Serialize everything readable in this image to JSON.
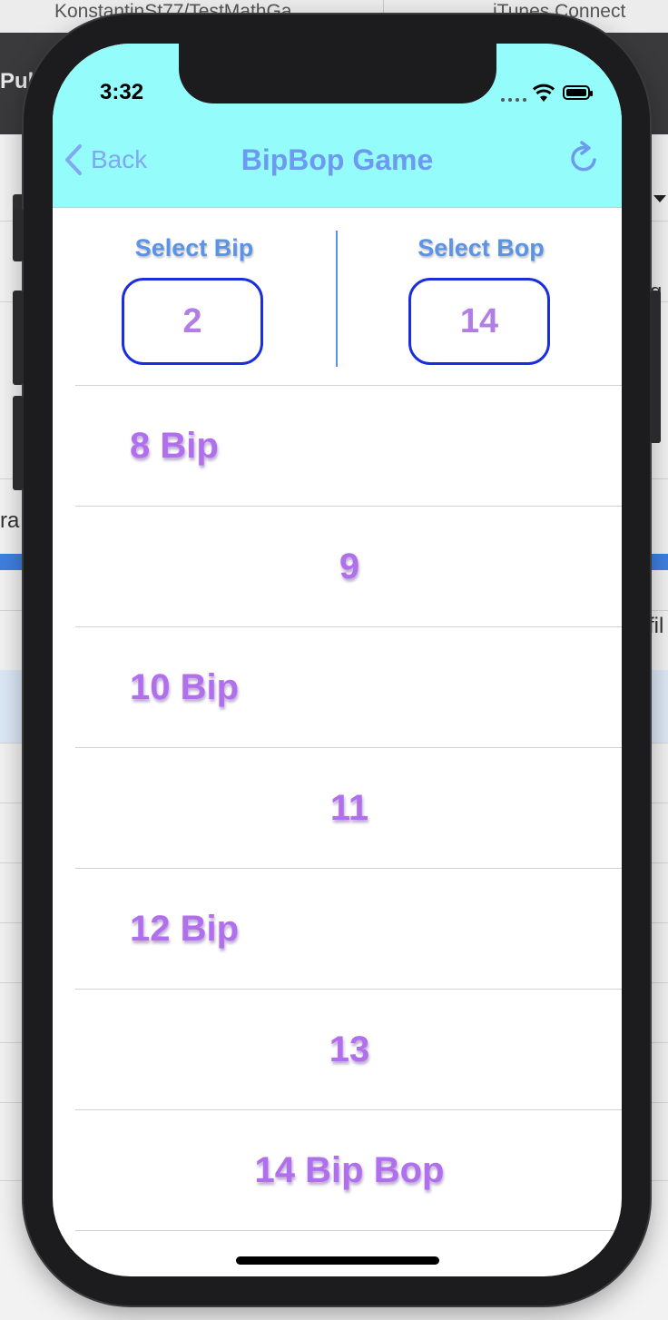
{
  "desktop": {
    "tabs": [
      "KonstantinSt77/TestMathGa",
      "iTunes Connect"
    ],
    "toolbar_text": "Pull",
    "fragments": {
      "left_mid": "ra",
      "right_top": "g",
      "right_mid": "fil"
    }
  },
  "status_bar": {
    "time": "3:32"
  },
  "nav": {
    "back_label": "Back",
    "title": "BipBop Game"
  },
  "selectors": {
    "bip": {
      "label": "Select Bip",
      "value": "2"
    },
    "bop": {
      "label": "Select Bop",
      "value": "14"
    }
  },
  "rows": [
    {
      "text": "8 Bip",
      "align": "left"
    },
    {
      "text": "9",
      "align": "center"
    },
    {
      "text": "10 Bip",
      "align": "left"
    },
    {
      "text": "11",
      "align": "center"
    },
    {
      "text": "12 Bip",
      "align": "left"
    },
    {
      "text": "13",
      "align": "center"
    },
    {
      "text": "14 Bip Bop",
      "align": "center"
    }
  ],
  "colors": {
    "nav_background": "#94fdfb",
    "accent_blue": "#5b93e6",
    "box_border": "#1a2de0",
    "row_text": "#b06fec"
  }
}
